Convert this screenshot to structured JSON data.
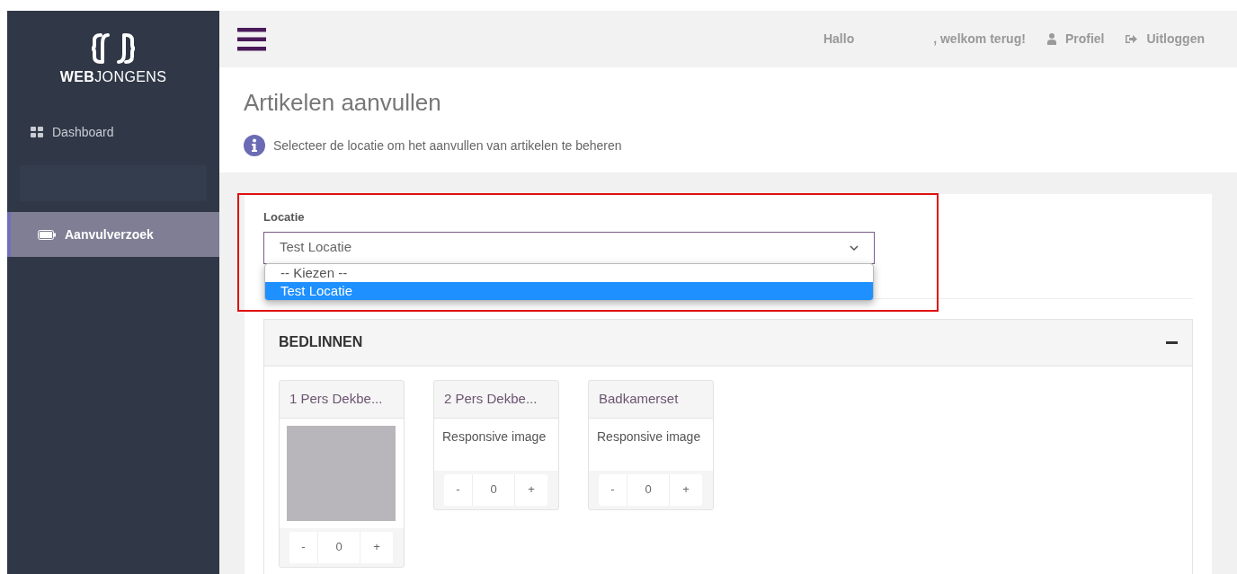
{
  "sidebar": {
    "logo_text_bold": "WEB",
    "logo_text": "JONGENS",
    "items": [
      {
        "label": "Dashboard",
        "selected": false
      },
      {
        "label": "Aanvulverzoek",
        "selected": true
      }
    ]
  },
  "header": {
    "greeting": "Hallo",
    "welcome": ", welkom terug!",
    "links": [
      {
        "label": "Profiel"
      },
      {
        "label": "Uitloggen"
      }
    ]
  },
  "page": {
    "title": "Artikelen aanvullen",
    "info": "Selecteer de locatie om het aanvullen van artikelen te beheren"
  },
  "location": {
    "label": "Locatie",
    "value": "Test Locatie",
    "expanded": true,
    "options": [
      {
        "label": "-- Kiezen --",
        "selected": false
      },
      {
        "label": "Test Locatie",
        "selected": true
      }
    ]
  },
  "category": {
    "title": "BEDLINNEN",
    "expanded": true,
    "products": [
      {
        "name": "1 Pers Dekbe...",
        "kind": "photo",
        "quantity": "0",
        "minus": "-",
        "plus": "+"
      },
      {
        "name": "2 Pers Dekbe...",
        "kind": "broken",
        "alt": "Responsive image",
        "quantity": "0",
        "minus": "-",
        "plus": "+"
      },
      {
        "name": "Badkamerset",
        "kind": "broken",
        "alt": "Responsive image",
        "quantity": "0",
        "minus": "-",
        "plus": "+"
      }
    ]
  }
}
